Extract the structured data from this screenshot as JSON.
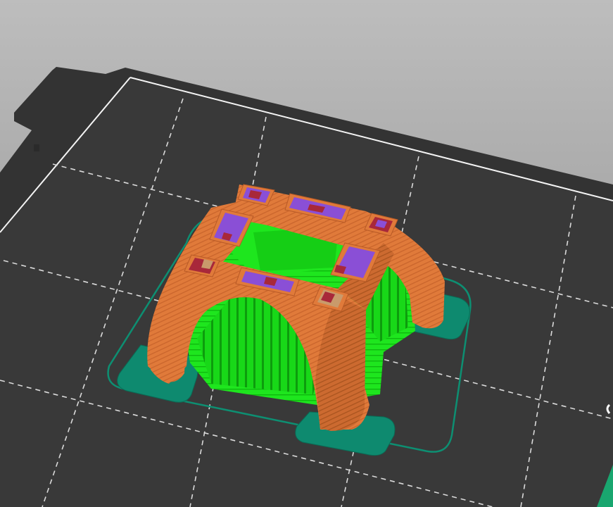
{
  "scene": {
    "view": "slicer-3d-preview",
    "background_top": "#b9b9b9",
    "background_bottom": "#8e8e8e",
    "bed_color": "#3a3a3a",
    "bed_edge_color": "#2b2b2b",
    "bed_outline_color": "#f2f2f2",
    "bed_grid_color": "#dcdcdc",
    "feature_colors": {
      "perimeter": "#e07a3a",
      "perimeter_shade": "#b85a26",
      "support": "#17e317",
      "support_shade": "#0fa70f",
      "skirt_brim": "#0e8a6f",
      "top_solid_infill": "#8a4fd6",
      "internal_infill": "#a8283a",
      "bridge_infill": "#c99a6b"
    }
  }
}
